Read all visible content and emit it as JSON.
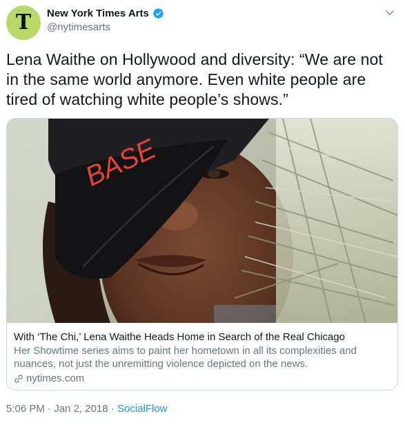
{
  "account": {
    "display_name": "New York Times Arts",
    "handle": "@nytimesarts",
    "avatar_glyph": "T"
  },
  "tweet": {
    "text": "Lena Waithe on Hollywood and diversity: “We are not in the same world anymore. Even white people are tired of watching white people’s shows.”"
  },
  "card": {
    "image_cap_text": "BASE",
    "title": "With ‘The Chi,’ Lena Waithe Heads Home in Search of the Real Chicago",
    "description": "Her Showtime series aims to paint her hometown in all its complexities and nuances, not just the unremitting violence depicted on the news.",
    "domain": "nytimes.com"
  },
  "meta": {
    "time": "5:06 PM",
    "separator1": "·",
    "date": "Jan 2, 2018",
    "separator2": "·",
    "source": "SocialFlow"
  },
  "colors": {
    "verified": "#1da1f2",
    "link": "#1b95e0",
    "secondary": "#657786",
    "avatar_bg": "#b9d86a"
  },
  "icons": [
    "verified-badge-icon",
    "chevron-down-icon",
    "link-icon"
  ]
}
